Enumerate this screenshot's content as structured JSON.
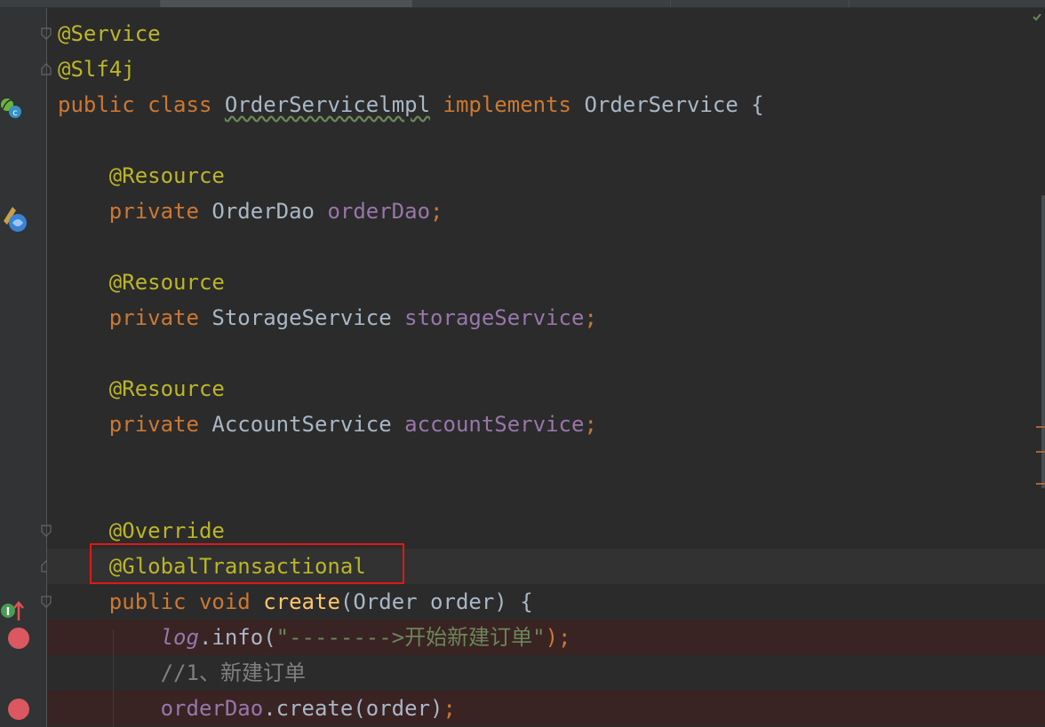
{
  "tabs": [
    "",
    "",
    "",
    "",
    "",
    "",
    ""
  ],
  "code_lines": [
    {
      "parts": [
        {
          "t": "@Service",
          "c": "ann"
        }
      ]
    },
    {
      "parts": [
        {
          "t": "@Slf4j",
          "c": "ann"
        }
      ]
    },
    {
      "parts": [
        {
          "t": "public ",
          "c": "kw"
        },
        {
          "t": "class ",
          "c": "kw"
        },
        {
          "t": "OrderServicelmpl",
          "c": "plain squiggle"
        },
        {
          "t": " implements ",
          "c": "kw"
        },
        {
          "t": "OrderService {",
          "c": "plain"
        }
      ]
    },
    {
      "parts": []
    },
    {
      "parts": [
        {
          "t": "    @Resource",
          "c": "ann"
        }
      ]
    },
    {
      "parts": [
        {
          "t": "    private ",
          "c": "kw"
        },
        {
          "t": "OrderDao ",
          "c": "plain"
        },
        {
          "t": "orderDao",
          "c": "fld"
        },
        {
          "t": ";",
          "c": "kw"
        }
      ]
    },
    {
      "parts": []
    },
    {
      "parts": [
        {
          "t": "    @Resource",
          "c": "ann"
        }
      ]
    },
    {
      "parts": [
        {
          "t": "    private ",
          "c": "kw"
        },
        {
          "t": "StorageService ",
          "c": "plain"
        },
        {
          "t": "storageService",
          "c": "fld"
        },
        {
          "t": ";",
          "c": "kw"
        }
      ]
    },
    {
      "parts": []
    },
    {
      "parts": [
        {
          "t": "    @Resource",
          "c": "ann"
        }
      ]
    },
    {
      "parts": [
        {
          "t": "    private ",
          "c": "kw"
        },
        {
          "t": "AccountService ",
          "c": "plain"
        },
        {
          "t": "accountService",
          "c": "fld"
        },
        {
          "t": ";",
          "c": "kw"
        }
      ]
    },
    {
      "parts": []
    },
    {
      "parts": []
    },
    {
      "parts": [
        {
          "t": "    @Override",
          "c": "ann"
        }
      ]
    },
    {
      "parts": [
        {
          "t": "    @GlobalTransactional",
          "c": "ann"
        }
      ],
      "cur": true
    },
    {
      "parts": [
        {
          "t": "    public ",
          "c": "kw"
        },
        {
          "t": "void ",
          "c": "kw"
        },
        {
          "t": "create",
          "c": "fn"
        },
        {
          "t": "(Order order) {",
          "c": "plain"
        }
      ]
    },
    {
      "parts": [
        {
          "t": "        ",
          "c": "plain"
        },
        {
          "t": "log",
          "c": "fld it"
        },
        {
          "t": ".info(",
          "c": "plain"
        },
        {
          "t": "\"-------->开始新建订单\"",
          "c": "str"
        },
        {
          "t": ");",
          "c": "kw"
        }
      ],
      "bp": true
    },
    {
      "parts": [
        {
          "t": "        //1、新建订单",
          "c": "cmt"
        }
      ]
    },
    {
      "parts": [
        {
          "t": "        ",
          "c": "plain"
        },
        {
          "t": "orderDao",
          "c": "fld"
        },
        {
          "t": ".create(order)",
          "c": "plain"
        },
        {
          "t": ";",
          "c": "kw"
        }
      ],
      "bp": true
    }
  ]
}
